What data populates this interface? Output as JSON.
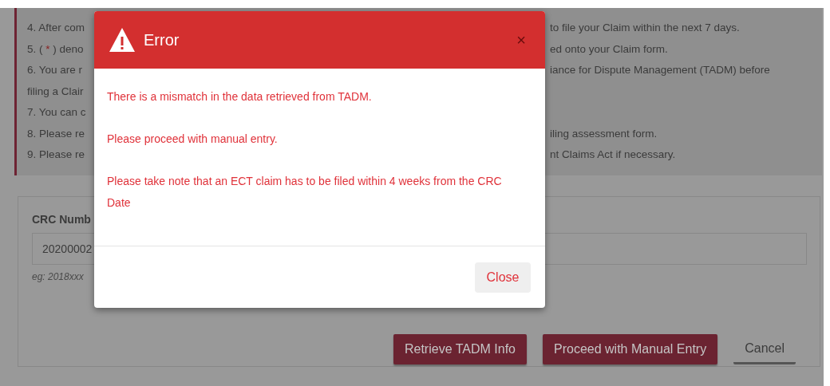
{
  "instructions": [
    {
      "left": [
        {
          "text": "4. After com",
          "kind": "plain"
        }
      ],
      "right": "to file your Claim within the next 7 days."
    },
    {
      "left": [
        {
          "text": "5. ( ",
          "kind": "plain"
        },
        {
          "text": "*",
          "kind": "required"
        },
        {
          "text": " ) deno",
          "kind": "plain"
        }
      ],
      "right": "ed onto your Claim form."
    },
    {
      "left": [
        {
          "text": "6. You are r",
          "kind": "plain"
        }
      ],
      "right": "iance for Dispute Management (TADM) before"
    },
    {
      "left": [
        {
          "text": "filing a Clair",
          "kind": "plain"
        }
      ]
    },
    {
      "left": [
        {
          "text": "7. You can c",
          "kind": "plain"
        }
      ]
    },
    {
      "left": [
        {
          "text": "8. Please re",
          "kind": "plain"
        }
      ],
      "right": "iling assessment form."
    },
    {
      "left": [
        {
          "text": "9. Please re",
          "kind": "plain"
        }
      ],
      "right": "nt Claims Act if necessary."
    }
  ],
  "form": {
    "label": "CRC Numb",
    "value": "20200002",
    "hint": "eg: 2018xxx",
    "buttons": [
      {
        "label": "Retrieve TADM Info",
        "kind": "primary"
      },
      {
        "label": "Proceed with Manual Entry",
        "kind": "primary"
      },
      {
        "label": "Cancel",
        "kind": "link"
      }
    ]
  },
  "modal": {
    "title": "Error",
    "close_glyph": "×",
    "messages": [
      "There is a mismatch in the data retrieved from TADM.",
      "Please proceed with manual entry.",
      "Please take note that an ECT claim has to be filed within 4 weeks from the CRC Date"
    ],
    "button": "Close"
  }
}
